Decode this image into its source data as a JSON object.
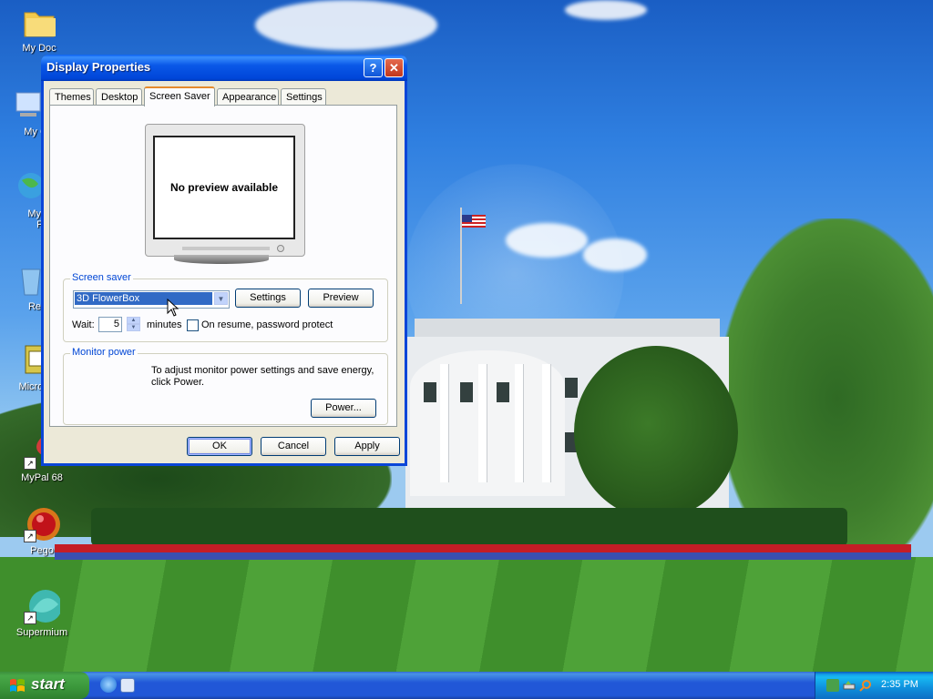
{
  "desktop": {
    "icons": [
      {
        "label": "My Doc",
        "icon": "folder-icon"
      },
      {
        "label": "My Co",
        "icon": "computer-icon"
      },
      {
        "label": "My N",
        "icon": "network-icon"
      },
      {
        "label": "Pla",
        "icon": "network-icon"
      },
      {
        "label": "Recy",
        "icon": "recycle-bin-icon"
      },
      {
        "label": "Microsof",
        "icon": "app-icon"
      },
      {
        "label": "MyPal 68",
        "icon": "mypal-icon"
      },
      {
        "label": "Pego",
        "icon": "pego-icon"
      },
      {
        "label": "Supermium",
        "icon": "supermium-icon"
      }
    ]
  },
  "window": {
    "title": "Display Properties",
    "help_glyph": "?",
    "close_glyph": "✕",
    "tabs": [
      {
        "label": "Themes"
      },
      {
        "label": "Desktop"
      },
      {
        "label": "Screen Saver"
      },
      {
        "label": "Appearance"
      },
      {
        "label": "Settings"
      }
    ],
    "active_tab": "Screen Saver",
    "preview_text": "No preview available",
    "screensaver": {
      "group_label": "Screen saver",
      "selected": "3D FlowerBox",
      "settings_button": "Settings",
      "preview_button": "Preview",
      "wait_label": "Wait:",
      "wait_value": "5",
      "wait_unit": "minutes",
      "password_label": "On resume, password protect",
      "password_checked": false
    },
    "monitor_power": {
      "group_label": "Monitor power",
      "line1": "To adjust monitor power settings and save energy,",
      "line2": "click Power.",
      "power_button": "Power..."
    },
    "buttons": {
      "ok": "OK",
      "cancel": "Cancel",
      "apply": "Apply"
    }
  },
  "taskbar": {
    "start_label": "start",
    "clock": "2:35 PM"
  },
  "colors": {
    "title_blue": "#0046d8",
    "start_green": "#3a963a",
    "active_tab_accent": "#e68b2c",
    "selection_blue": "#316ac5"
  }
}
